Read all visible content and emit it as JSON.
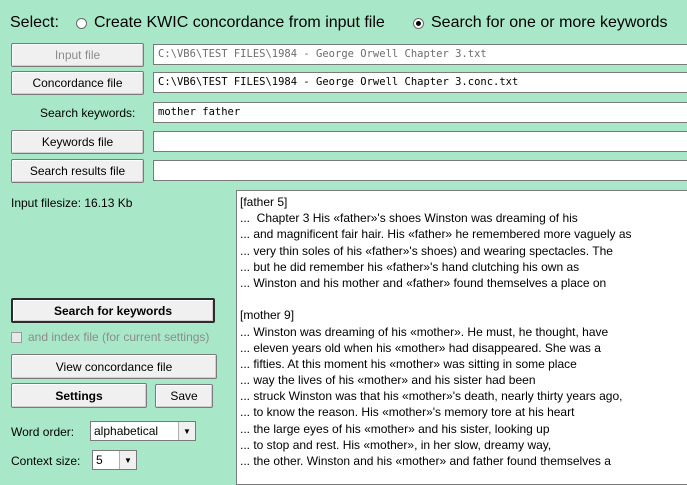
{
  "select_label": "Select:",
  "mode_options": [
    {
      "label": "Create KWIC concordance from input file",
      "checked": false
    },
    {
      "label": "Search for one or more keywords",
      "checked": true
    }
  ],
  "buttons": {
    "input_file": "Input file",
    "concordance_file": "Concordance file",
    "keywords_file": "Keywords file",
    "search_results_file": "Search results file",
    "search_for_keywords": "Search for keywords",
    "view_concordance_file": "View concordance file",
    "settings": "Settings",
    "save": "Save"
  },
  "fields": {
    "input_file_path": "C:\\VB6\\TEST FILES\\1984 - George Orwell Chapter 3.txt",
    "concordance_file_path": "C:\\VB6\\TEST FILES\\1984 - George Orwell Chapter 3.conc.txt",
    "search_keywords_label": "Search keywords:",
    "search_keywords_value": "mother father",
    "keywords_file_value": "",
    "search_results_file_value": ""
  },
  "input_filesize": "Input filesize: 16.13 Kb",
  "index_file_checkbox": "and index file (for current settings)",
  "word_order": {
    "label": "Word order:",
    "value": "alphabetical"
  },
  "context_size": {
    "label": "Context size:",
    "value": "5"
  },
  "results": [
    "[father 5]",
    "...  Chapter 3 His «father»'s shoes Winston was dreaming of his",
    "... and magnificent fair hair. His «father» he remembered more vaguely as",
    "... very thin soles of his «father»'s shoes) and wearing spectacles. The",
    "... but he did remember his «father»'s hand clutching his own as",
    "... Winston and his mother and «father» found themselves a place on",
    "",
    "[mother 9]",
    "... Winston was dreaming of his «mother». He must, he thought, have",
    "... eleven years old when his «mother» had disappeared. She was a",
    "... fifties. At this moment his «mother» was sitting in some place",
    "... way the lives of his «mother» and his sister had been",
    "... struck Winston was that his «mother»'s death, nearly thirty years ago,",
    "... to know the reason. His «mother»'s memory tore at his heart",
    "... the large eyes of his «mother» and his sister, looking up",
    "... to stop and rest. His «mother», in her slow, dreamy way,",
    "... the other. Winston and his «mother» and father found themselves a"
  ]
}
